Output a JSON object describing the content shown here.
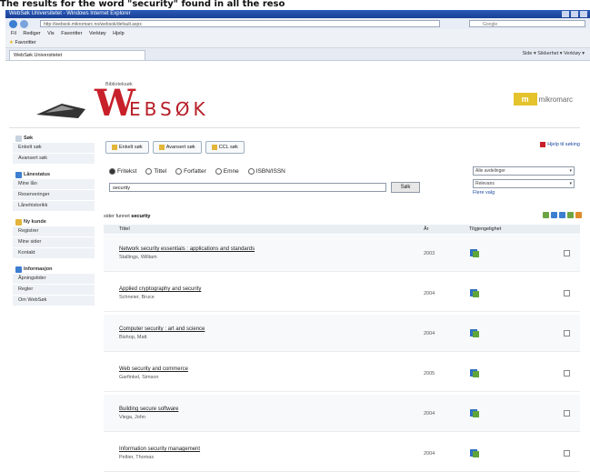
{
  "caption": "The results for the word \"security\" found in all the reso",
  "browser": {
    "window_title": "WebSøk Universitetet - Windows Internet Explorer",
    "url": "http://websok.mikromarc.no/websok/default.aspx",
    "search_placeholder": "Google",
    "menu": [
      "Fil",
      "Rediger",
      "Vis",
      "Favoritter",
      "Verktøy",
      "Hjelp"
    ],
    "favorites_label": "Favoritter",
    "tab_title": "WebSøk Universitetet",
    "tools": "Side ▾  Sikkerhet ▾  Verktøy ▾"
  },
  "header": {
    "tagline": "Biblioteksøk",
    "logo_w": "W",
    "logo_rest": "EBSØK",
    "partner_mark": "m",
    "partner_text": "mikromarc"
  },
  "sidebar": [
    {
      "head": "Søk",
      "icon_color": "#c9d3df",
      "items": [
        "Enkelt søk",
        "Avansert søk"
      ]
    },
    {
      "head": "Lånestatus",
      "icon_color": "#3c7ed0",
      "items": [
        "Mine lån",
        "Reserveringer",
        "Lånehistorikk"
      ]
    },
    {
      "head": "Ny kunde",
      "icon_color": "#e3b43b",
      "items": [
        "Registrer",
        "Mine sider",
        "Kontakt"
      ]
    },
    {
      "head": "Informasjon",
      "icon_color": "#3c7ed0",
      "items": [
        "Åpningstider",
        "Regler",
        "Om WebSøk"
      ]
    }
  ],
  "content": {
    "tabs": [
      "Enkelt søk",
      "Avansert søk",
      "CCL søk"
    ],
    "help_link": "Hjelp til søking",
    "filters": [
      "Fritekst",
      "Tittel",
      "Forfatter",
      "Emne",
      "ISBN/ISSN"
    ],
    "search_value": "security",
    "search_button": "Søk",
    "select_library": "Alle avdelinger",
    "select_sort": "Relevans",
    "more_link": "Flere valg",
    "results_prefix": "sider funnet",
    "results_query": "security",
    "th_title": "Tittel",
    "th_year": "År",
    "th_avail": "Tilgjengelighet",
    "rows": [
      {
        "title": "Network security essentials : applications and standards",
        "author": "Stallings, William",
        "year": "2003"
      },
      {
        "title": "Applied cryptography and security",
        "author": "Schneier, Bruce",
        "year": "2004"
      },
      {
        "title": "Computer security : art and science",
        "author": "Bishop, Matt",
        "year": "2004"
      },
      {
        "title": "Web security and commerce",
        "author": "Garfinkel, Simson",
        "year": "2005"
      },
      {
        "title": "Building secure software",
        "author": "Viega, John",
        "year": "2004"
      },
      {
        "title": "Information security management",
        "author": "Peltier, Thomas",
        "year": "2004"
      }
    ]
  }
}
